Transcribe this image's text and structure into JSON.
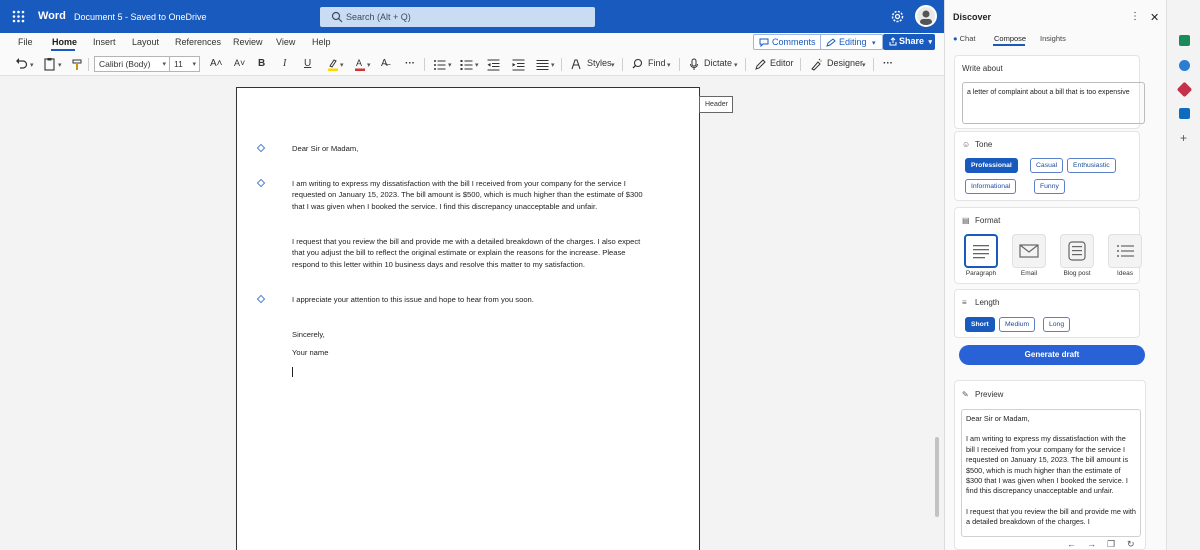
{
  "titlebar": {
    "app_name": "Word",
    "doc_name": "Document 5 - Saved to OneDrive",
    "search_placeholder": "Search (Alt + Q)"
  },
  "menu": [
    "File",
    "Home",
    "Insert",
    "Layout",
    "References",
    "Review",
    "View",
    "Help"
  ],
  "toolbar": {
    "comments": "Comments",
    "editing": "Editing",
    "share": "Share",
    "font_name": "Calibri (Body)",
    "font_size": "11",
    "styles": "Styles",
    "find": "Find",
    "dictate": "Dictate",
    "editor": "Editor",
    "designer": "Designer",
    "more": "···"
  },
  "document": {
    "header_tag": "Header",
    "paragraphs": [
      "Dear Sir or Madam,",
      "I am writing to express my dissatisfaction with the bill I received from your company for the service I requested on January 15, 2023. The bill amount is $500, which is much higher than the estimate of $300 that I was given when I booked the service. I find this discrepancy unacceptable and unfair.",
      "I request that you review the bill and provide me with a detailed breakdown of the charges. I also expect that you adjust the bill to reflect the original estimate or explain the reasons for the increase. Please respond to this letter within 10 business days and resolve this matter to my satisfaction.",
      "I appreciate your attention to this issue and hope to hear from you soon.",
      "Sincerely,",
      "Your name"
    ]
  },
  "pane": {
    "title": "Discover",
    "tabs": [
      "Chat",
      "Compose",
      "Insights"
    ],
    "write_about_label": "Write about",
    "write_about_value": "a letter of complaint about a bill that is too expensive",
    "tone_label": "Tone",
    "tones": [
      "Professional",
      "Casual",
      "Enthusiastic",
      "Informational",
      "Funny"
    ],
    "format_label": "Format",
    "formats": [
      "Paragraph",
      "Email",
      "Blog post",
      "Ideas"
    ],
    "length_label": "Length",
    "lengths": [
      "Short",
      "Medium",
      "Long"
    ],
    "generate_label": "Generate draft",
    "preview_label": "Preview",
    "preview_paragraphs": [
      "Dear Sir or Madam,",
      "I am writing to express my dissatisfaction with the bill I received from your company for the service I requested on January 15, 2023. The bill amount is $500, which is much higher than the estimate of $300 that I was given when I booked the service. I find this discrepancy unacceptable and unfair.",
      "I request that you review the bill and provide me with a detailed breakdown of the charges. I"
    ]
  },
  "colors": {
    "brand": "#185abd",
    "accent_button": "#2862d6"
  },
  "icons": [
    "waffle-icon",
    "search-icon",
    "gear-icon",
    "undo-icon",
    "clipboard-icon",
    "format-painter-icon",
    "bold-icon",
    "italic-icon",
    "underline-icon",
    "highlight-icon",
    "font-color-icon",
    "bullets-icon",
    "numbering-icon",
    "indent-icon",
    "align-icon",
    "styles-icon",
    "find-icon",
    "mic-icon",
    "editor-icon",
    "designer-icon"
  ]
}
